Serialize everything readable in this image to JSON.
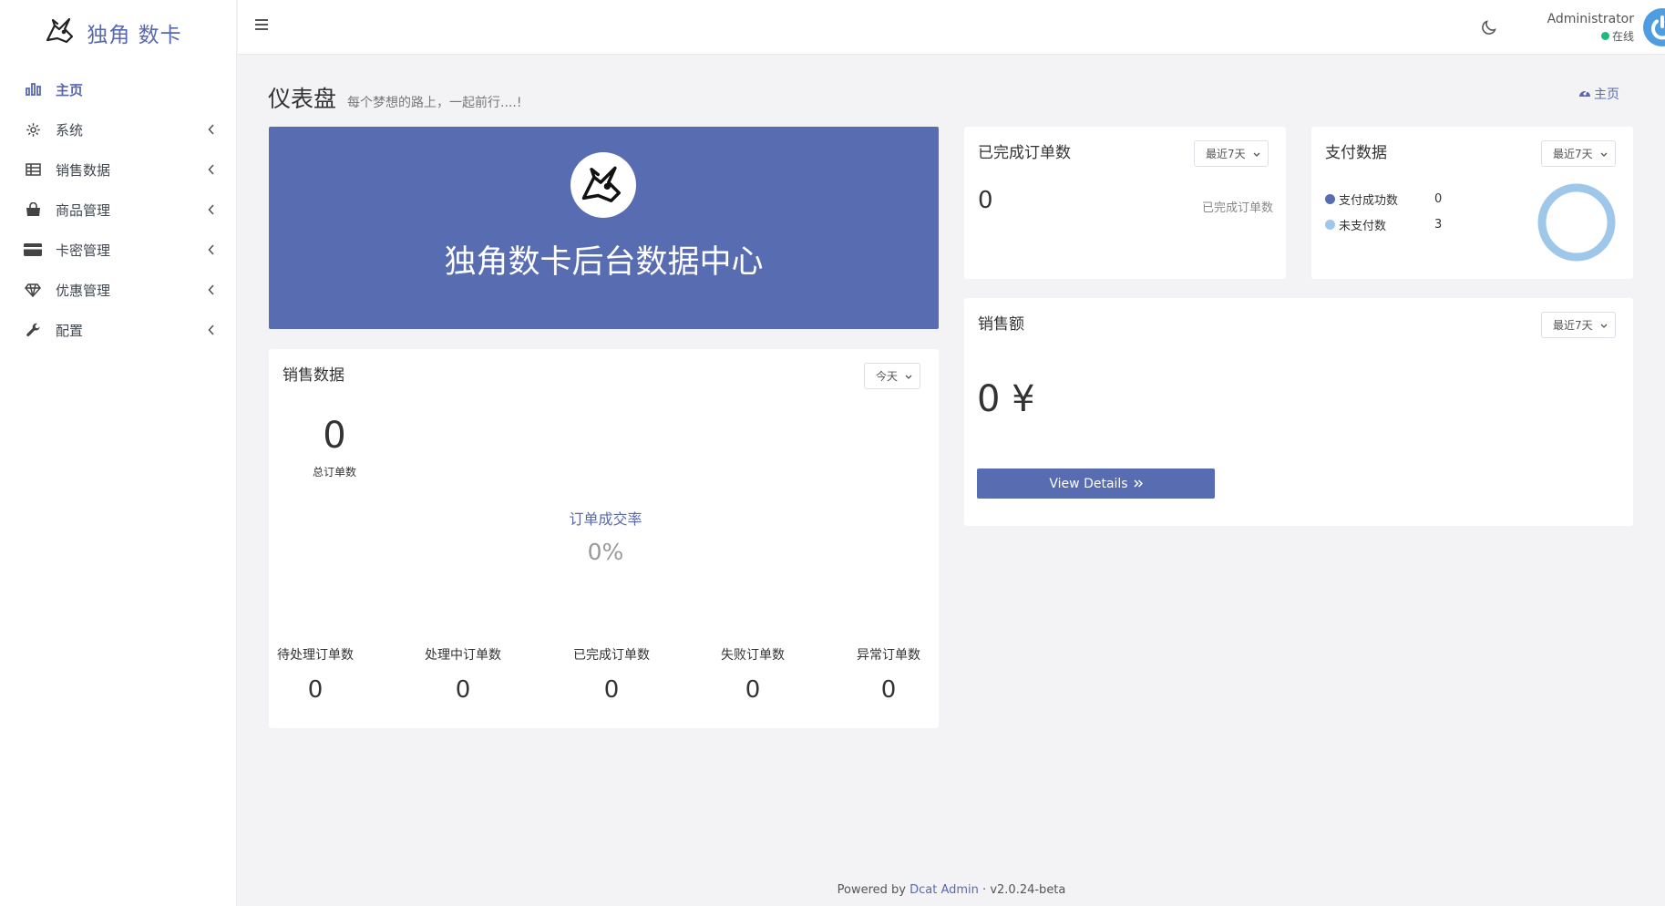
{
  "brand": {
    "name": "独角 数卡"
  },
  "sidebar": {
    "items": [
      {
        "label": "主页",
        "icon": "bar-chart-icon",
        "active": true
      },
      {
        "label": "系统",
        "icon": "gear-icon"
      },
      {
        "label": "销售数据",
        "icon": "table-icon"
      },
      {
        "label": "商品管理",
        "icon": "shopping-bag-icon"
      },
      {
        "label": "卡密管理",
        "icon": "credit-card-icon"
      },
      {
        "label": "优惠管理",
        "icon": "diamond-icon"
      },
      {
        "label": "配置",
        "icon": "wrench-icon"
      }
    ]
  },
  "header": {
    "user_name": "Administrator",
    "user_status": "在线"
  },
  "page": {
    "title": "仪表盘",
    "subtitle": "每个梦想的路上，一起前行....!",
    "breadcrumb": "主页"
  },
  "banner": {
    "title": "独角数卡后台数据中心"
  },
  "sales": {
    "title": "销售数据",
    "period": "今天",
    "total_value": "0",
    "total_label": "总订单数",
    "rate_label": "订单成交率",
    "rate_value": "0%",
    "stats": [
      {
        "label": "待处理订单数",
        "value": "0"
      },
      {
        "label": "处理中订单数",
        "value": "0"
      },
      {
        "label": "已完成订单数",
        "value": "0"
      },
      {
        "label": "失败订单数",
        "value": "0"
      },
      {
        "label": "异常订单数",
        "value": "0"
      }
    ]
  },
  "completed": {
    "title": "已完成订单数",
    "period": "最近7天",
    "value": "0",
    "label": "已完成订单数"
  },
  "payment": {
    "title": "支付数据",
    "period": "最近7天",
    "legend": [
      {
        "name": "支付成功数",
        "value": "0",
        "color": "#586cb1"
      },
      {
        "name": "未支付数",
        "value": "3",
        "color": "#9ec7ea"
      }
    ]
  },
  "revenue": {
    "title": "销售额",
    "period": "最近7天",
    "value": "0 ¥",
    "button": "View Details"
  },
  "footer": {
    "powered_by": "Powered by",
    "link": "Dcat Admin",
    "separator": "·",
    "version": "v2.0.24-beta"
  },
  "colors": {
    "primary": "#586cb1",
    "online": "#21b978",
    "avatar": "#4d9de0"
  }
}
